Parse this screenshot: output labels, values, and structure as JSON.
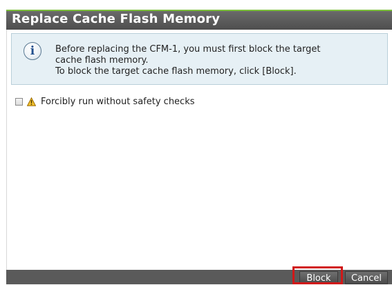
{
  "dialog": {
    "title": "Replace Cache Flash Memory"
  },
  "info": {
    "icon": "info-icon",
    "line1": "Before replacing the CFM-1, you must first block the target",
    "line2": "cache flash memory.",
    "line3": "To block the target cache flash memory, click [Block]."
  },
  "option": {
    "checked": false,
    "warning_icon": "warning-icon",
    "label": "Forcibly run without safety checks"
  },
  "footer": {
    "block_label": "Block",
    "cancel_label": "Cancel"
  },
  "colors": {
    "title_bar": "#5a5a5a",
    "title_accent": "#7bbf3a",
    "info_background": "#e6f0f5",
    "highlight": "#d01818"
  }
}
